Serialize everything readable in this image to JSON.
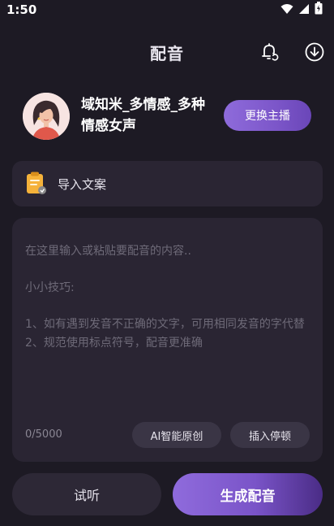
{
  "status_bar": {
    "time": "1:50"
  },
  "header": {
    "title": "配音",
    "icons": [
      "bell-refresh-icon",
      "download-icon"
    ]
  },
  "anchor": {
    "name": "域知米_多情感_多种情感女声",
    "change_button": "更换主播"
  },
  "import": {
    "label": "导入文案",
    "icon": "clipboard-icon"
  },
  "editor": {
    "placeholder": "在这里输入或粘贴要配音的内容..",
    "tips_title": "小小技巧:",
    "tip1": "1、如有遇到发音不正确的文字，可用相同发音的字代替",
    "tip2": "2、规范使用标点符号，配音更准确",
    "counter": "0/5000",
    "ai_button": "AI智能原创",
    "pause_button": "插入停顿"
  },
  "actions": {
    "listen": "试听",
    "generate": "生成配音"
  },
  "colors": {
    "background": "#1d1a24",
    "card": "#2a2533",
    "accent": "#8e6bdb"
  }
}
